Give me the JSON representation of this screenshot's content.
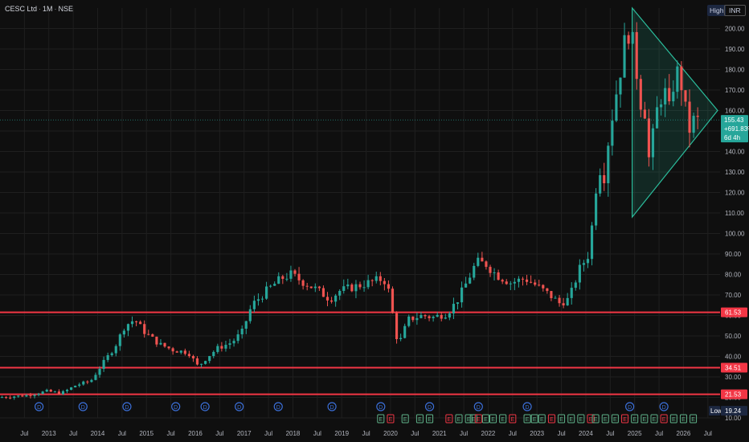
{
  "header": {
    "symbol": "CESC Ltd",
    "timeframe": "1M",
    "exchange": "NSE",
    "high_label": "High",
    "currency": "INR"
  },
  "current": {
    "price": "155.43",
    "change": "+691.83%",
    "countdown": "6d 4h",
    "price_value": 155.43
  },
  "colors": {
    "up": "#26a69a",
    "down": "#ef5350",
    "level": "#f23645",
    "triangle": "#2bbd9c",
    "background": "#0f0f0f",
    "grid": "#1f1f1f",
    "earnings_e": "#5fb38a",
    "dividend_d": "#3b6fd8"
  },
  "chart_data": {
    "type": "candlestick",
    "title": "CESC Ltd · 1M · NSE",
    "y_axis": {
      "min": 10,
      "max": 210,
      "ticks": [
        10,
        20,
        30,
        40,
        50,
        60,
        70,
        80,
        90,
        100,
        110,
        120,
        130,
        140,
        150,
        160,
        170,
        180,
        190,
        200
      ],
      "tick_labels": [
        "10.00",
        "20.00",
        "30.00",
        "40.00",
        "50.00",
        "60.00",
        "70.00",
        "80.00",
        "90.00",
        "100.00",
        "110.00",
        "120.00",
        "130.00",
        "140.00",
        "150.00",
        "160.00",
        "170.00",
        "180.00",
        "190.00",
        "200.00"
      ],
      "side": "right",
      "label": ""
    },
    "x_axis": {
      "start": 2012.5,
      "end": 2026.7,
      "ticks": [
        {
          "t": 2012.5,
          "label": "Jul"
        },
        {
          "t": 2013,
          "label": "2013"
        },
        {
          "t": 2013.5,
          "label": "Jul"
        },
        {
          "t": 2014,
          "label": "2014"
        },
        {
          "t": 2014.5,
          "label": "Jul"
        },
        {
          "t": 2015,
          "label": "2015"
        },
        {
          "t": 2015.5,
          "label": "Jul"
        },
        {
          "t": 2016,
          "label": "2016"
        },
        {
          "t": 2016.5,
          "label": "Jul"
        },
        {
          "t": 2017,
          "label": "2017"
        },
        {
          "t": 2017.5,
          "label": "Jul"
        },
        {
          "t": 2018,
          "label": "2018"
        },
        {
          "t": 2018.5,
          "label": "Jul"
        },
        {
          "t": 2019,
          "label": "2019"
        },
        {
          "t": 2019.5,
          "label": "Jul"
        },
        {
          "t": 2020,
          "label": "2020"
        },
        {
          "t": 2020.5,
          "label": "Jul"
        },
        {
          "t": 2021,
          "label": "2021"
        },
        {
          "t": 2021.5,
          "label": "Jul"
        },
        {
          "t": 2022,
          "label": "2022"
        },
        {
          "t": 2022.5,
          "label": "Jul"
        },
        {
          "t": 2023,
          "label": "2023"
        },
        {
          "t": 2023.5,
          "label": "Jul"
        },
        {
          "t": 2024,
          "label": "2024"
        },
        {
          "t": 2024.5,
          "label": "Jul"
        },
        {
          "t": 2025,
          "label": "2025"
        },
        {
          "t": 2025.5,
          "label": "Jul"
        },
        {
          "t": 2026,
          "label": "2026"
        },
        {
          "t": 2026.5,
          "label": "Jul"
        }
      ]
    },
    "price_anchors": [
      [
        2012.0,
        20
      ],
      [
        2012.6,
        21
      ],
      [
        2013.0,
        23
      ],
      [
        2013.3,
        22
      ],
      [
        2013.6,
        26
      ],
      [
        2013.9,
        28
      ],
      [
        2014.1,
        35
      ],
      [
        2014.4,
        45
      ],
      [
        2014.6,
        55
      ],
      [
        2014.8,
        58
      ],
      [
        2015.0,
        52
      ],
      [
        2015.3,
        46
      ],
      [
        2015.6,
        43
      ],
      [
        2015.9,
        42
      ],
      [
        2016.1,
        35
      ],
      [
        2016.3,
        40
      ],
      [
        2016.5,
        44
      ],
      [
        2016.8,
        47
      ],
      [
        2017.0,
        52
      ],
      [
        2017.2,
        65
      ],
      [
        2017.5,
        72
      ],
      [
        2017.8,
        78
      ],
      [
        2018.0,
        80
      ],
      [
        2018.2,
        77
      ],
      [
        2018.5,
        73
      ],
      [
        2018.8,
        68
      ],
      [
        2019.0,
        72
      ],
      [
        2019.3,
        74
      ],
      [
        2019.6,
        76
      ],
      [
        2019.9,
        78
      ],
      [
        2020.0,
        72
      ],
      [
        2020.2,
        45
      ],
      [
        2020.4,
        58
      ],
      [
        2020.7,
        60
      ],
      [
        2020.9,
        59
      ],
      [
        2021.2,
        61
      ],
      [
        2021.4,
        67
      ],
      [
        2021.6,
        76
      ],
      [
        2021.8,
        86
      ],
      [
        2022.0,
        85
      ],
      [
        2022.2,
        80
      ],
      [
        2022.5,
        76
      ],
      [
        2022.8,
        78
      ],
      [
        2023.0,
        75
      ],
      [
        2023.3,
        70
      ],
      [
        2023.5,
        66
      ],
      [
        2023.7,
        68
      ],
      [
        2023.9,
        82
      ],
      [
        2024.1,
        90
      ],
      [
        2024.2,
        110
      ],
      [
        2024.3,
        135
      ],
      [
        2024.4,
        125
      ],
      [
        2024.5,
        145
      ],
      [
        2024.6,
        160
      ],
      [
        2024.75,
        180
      ],
      [
        2024.85,
        195
      ],
      [
        2024.95,
        200
      ],
      [
        2025.05,
        185
      ],
      [
        2025.15,
        165
      ],
      [
        2025.25,
        160
      ],
      [
        2025.35,
        132
      ],
      [
        2025.45,
        155
      ],
      [
        2025.55,
        165
      ],
      [
        2025.65,
        170
      ],
      [
        2025.75,
        160
      ],
      [
        2025.85,
        175
      ],
      [
        2025.95,
        180
      ],
      [
        2026.05,
        165
      ],
      [
        2026.15,
        150
      ],
      [
        2026.25,
        155
      ]
    ],
    "levels": [
      {
        "value": 61.53,
        "label": "61.53"
      },
      {
        "value": 34.51,
        "label": "34.51"
      },
      {
        "value": 21.53,
        "label": "21.53"
      }
    ],
    "low_marker": {
      "label": "Low",
      "value": "19.24"
    },
    "triangle": {
      "apex_top": [
        2024.95,
        210
      ],
      "apex_bottom": [
        2024.95,
        108
      ],
      "apex_right": [
        2026.7,
        160
      ]
    },
    "events": {
      "dividends": [
        2012.8,
        2013.7,
        2014.6,
        2015.6,
        2016.2,
        2016.9,
        2017.7,
        2018.8,
        2019.8,
        2020.8,
        2021.8,
        2022.8,
        2024.9,
        2025.6
      ],
      "earnings": [
        2019.8,
        2020.0,
        2020.3,
        2020.6,
        2020.8,
        2021.2,
        2021.4,
        2021.6,
        2021.7,
        2021.8,
        2021.95,
        2022.1,
        2022.3,
        2022.5,
        2022.8,
        2022.95,
        2023.1,
        2023.3,
        2023.5,
        2023.7,
        2023.9,
        2024.1,
        2024.2,
        2024.4,
        2024.6,
        2024.8,
        2025.0,
        2025.2,
        2025.4,
        2025.6,
        2025.8,
        2026.0,
        2026.2
      ],
      "label_d": "D",
      "label_e": "E"
    }
  }
}
